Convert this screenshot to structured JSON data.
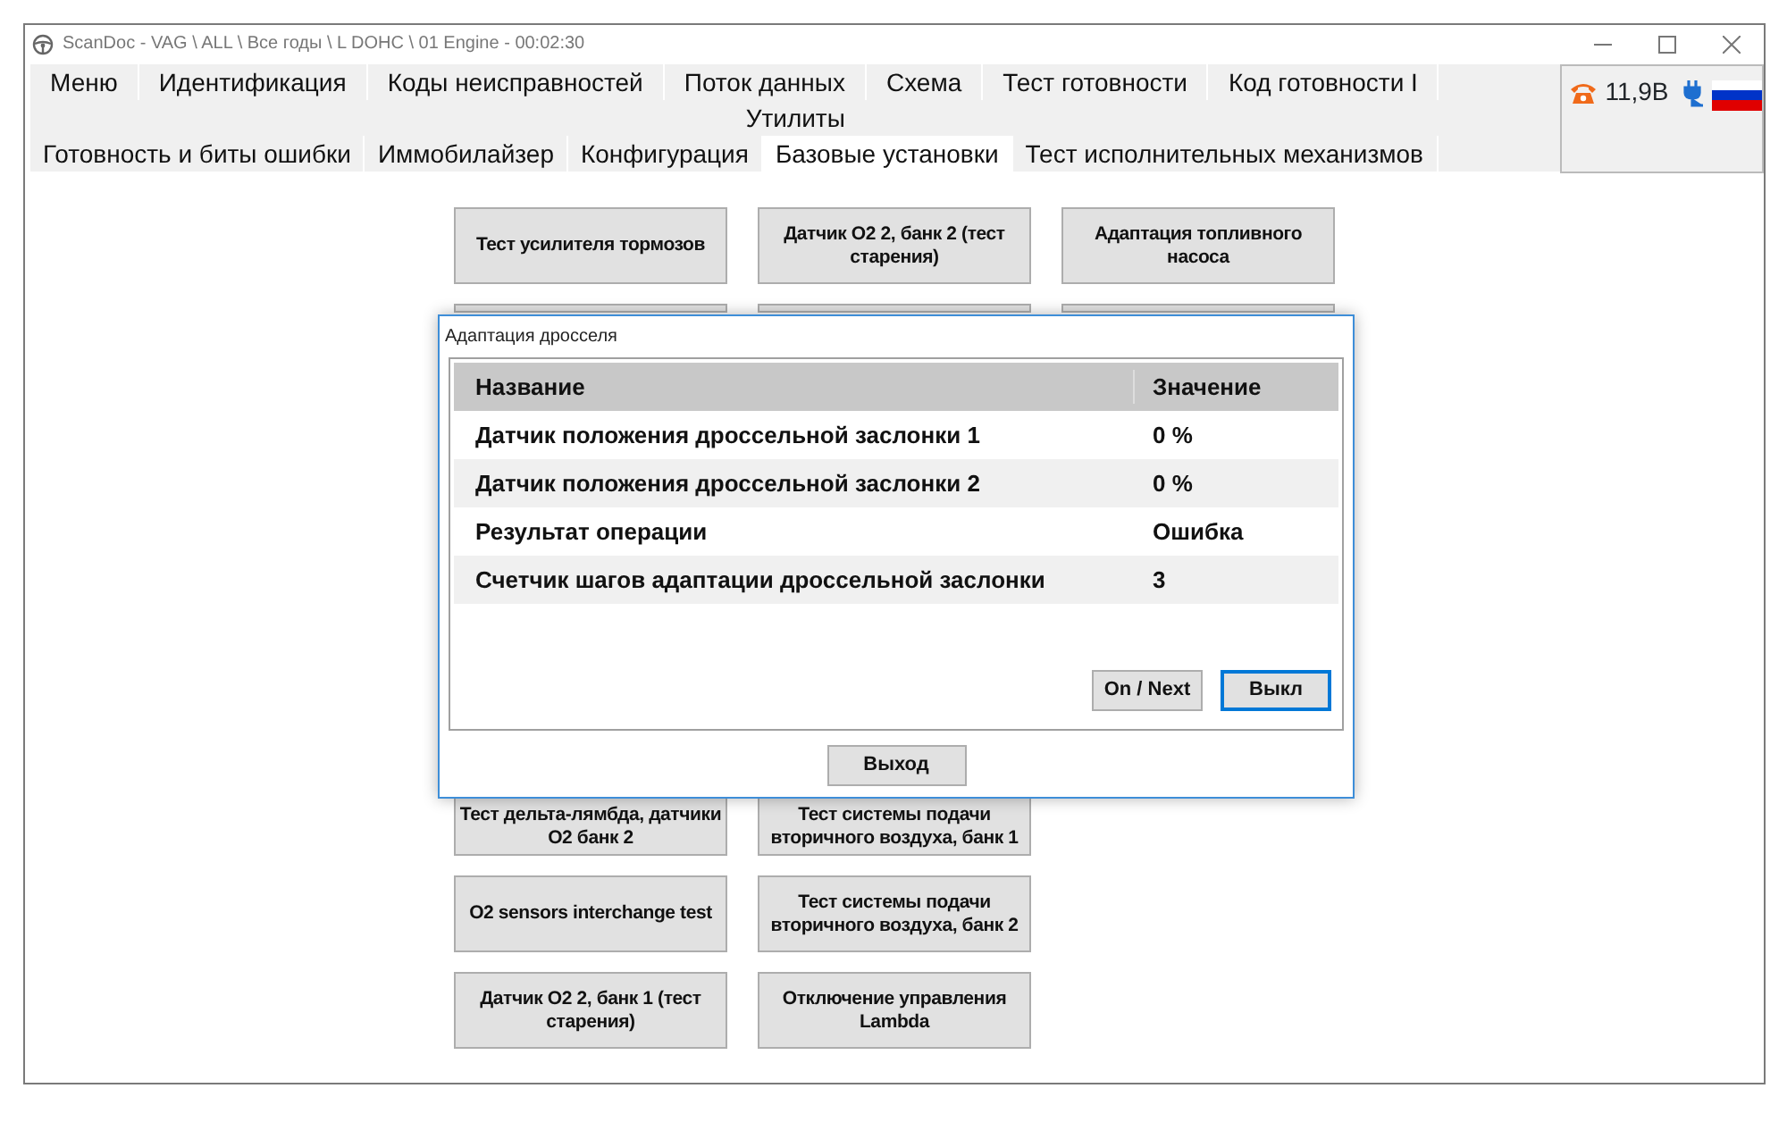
{
  "window": {
    "title": "ScanDoc - VAG \\ ALL \\ Все годы \\ L DOHC \\ 01 Engine - 00:02:30"
  },
  "menu": [
    {
      "label": "Меню"
    },
    {
      "label": "Идентификация"
    },
    {
      "label": "Коды неисправностей"
    },
    {
      "label": "Поток данных"
    },
    {
      "label": "Схема"
    },
    {
      "label": "Тест готовности"
    },
    {
      "label": "Код готовности I"
    }
  ],
  "menu_row_2": {
    "label": "Утилиты"
  },
  "tabs": [
    {
      "label": "Готовность и биты ошибки",
      "selected": false
    },
    {
      "label": "Иммобилайзер",
      "selected": false
    },
    {
      "label": "Конфигурация",
      "selected": false
    },
    {
      "label": "Базовые установки",
      "selected": true
    },
    {
      "label": "Тест исполнительных механизмов",
      "selected": false
    }
  ],
  "status": {
    "voltage": "11,9В"
  },
  "top_buttons": [
    {
      "kind": "button",
      "label": "Тест усилителя тормозов"
    },
    {
      "kind": "button",
      "label": "Датчик O2 2, банк 2 (тест старения)"
    },
    {
      "kind": "button",
      "label": "Адаптация топливного насоса"
    },
    {
      "kind": "covered"
    },
    {
      "kind": "covered"
    },
    {
      "kind": "covered"
    }
  ],
  "bottom_buttons": [
    {
      "kind": "clipped",
      "label": "Тест дельта-лямбда, датчики O2 банк 2"
    },
    {
      "kind": "clipped",
      "label": "Тест системы подачи вторичного воздуха, банк 1"
    },
    {
      "kind": "empty"
    },
    {
      "kind": "button",
      "label": "O2 sensors interchange test"
    },
    {
      "kind": "button",
      "label": "Тест системы подачи вторичного воздуха, банк 2"
    },
    {
      "kind": "empty"
    },
    {
      "kind": "button",
      "label": "Датчик O2 2, банк 1 (тест старения)"
    },
    {
      "kind": "button",
      "label": "Отключение управления Lambda"
    },
    {
      "kind": "empty"
    }
  ],
  "dialog": {
    "title": "Адаптация дросселя",
    "table": {
      "columns": [
        "Название",
        "Значение"
      ],
      "rows": [
        [
          "Датчик положения дроссельной заслонки 1",
          "0 %"
        ],
        [
          "Датчик положения дроссельной заслонки 2",
          "0 %"
        ],
        [
          "Результат операции",
          "Ошибка"
        ],
        [
          "Счетчик шагов адаптации дроссельной заслонки",
          "3"
        ]
      ]
    },
    "buttons": [
      {
        "label": "On / Next",
        "focused": false
      },
      {
        "label": "Выкл",
        "focused": true
      }
    ],
    "exit_button": "Выход"
  }
}
